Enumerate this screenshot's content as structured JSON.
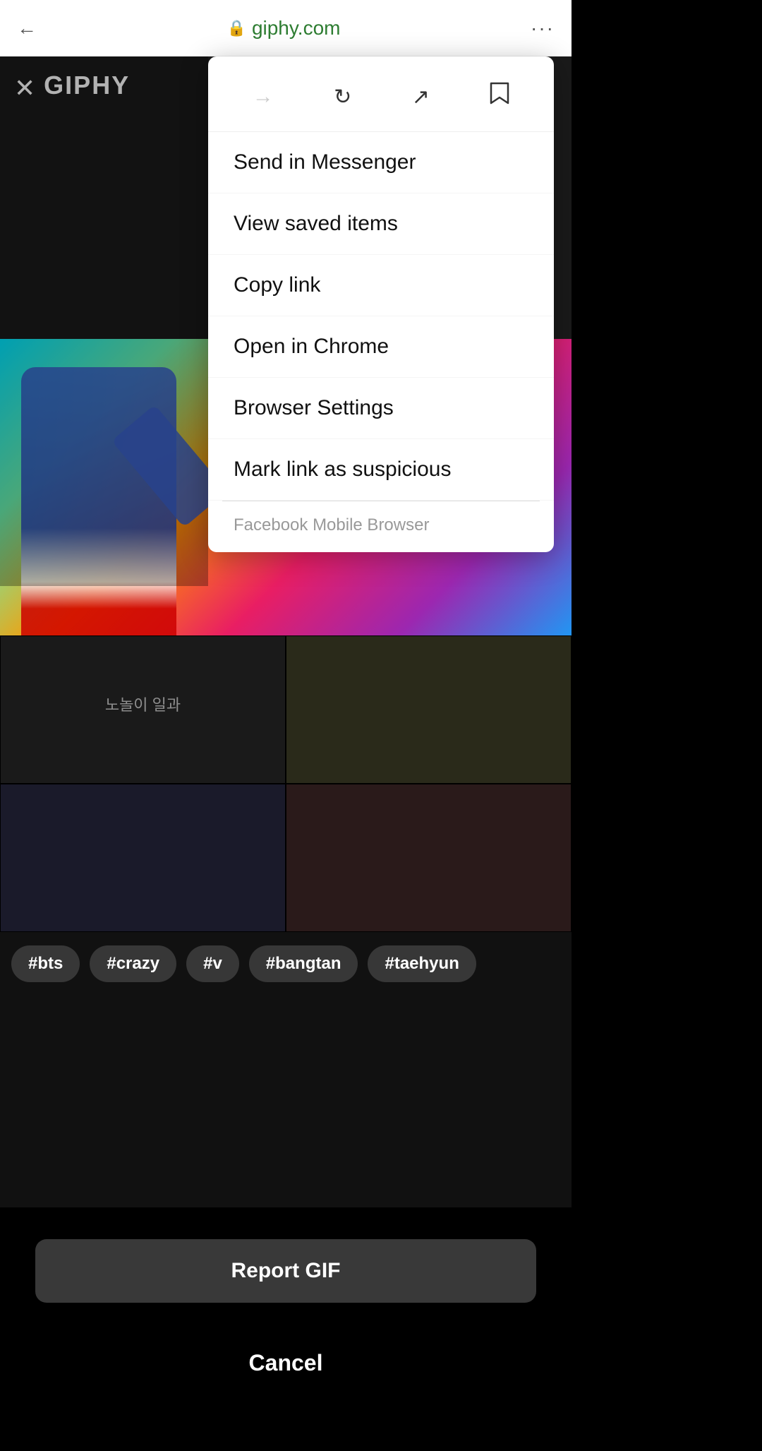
{
  "browser": {
    "url": "giphy.com",
    "back_label": "←",
    "more_label": "···"
  },
  "giphy": {
    "logo": "GIPHY",
    "close": "✕"
  },
  "menu": {
    "toolbar": {
      "forward_icon": "→",
      "refresh_icon": "↻",
      "share_icon": "↗",
      "bookmark_icon": "🔖"
    },
    "items": [
      {
        "label": "Send in Messenger"
      },
      {
        "label": "View saved items"
      },
      {
        "label": "Copy link"
      },
      {
        "label": "Open in Chrome"
      },
      {
        "label": "Browser Settings"
      },
      {
        "label": "Mark link as suspicious"
      }
    ],
    "footer": "Facebook Mobile Browser"
  },
  "hashtags": [
    "#bts",
    "#crazy",
    "#v",
    "#bangtan",
    "#taehyun"
  ],
  "actions": {
    "report_gif": "Report GIF",
    "cancel": "Cancel"
  },
  "thumb_text": "노놀이 일과"
}
